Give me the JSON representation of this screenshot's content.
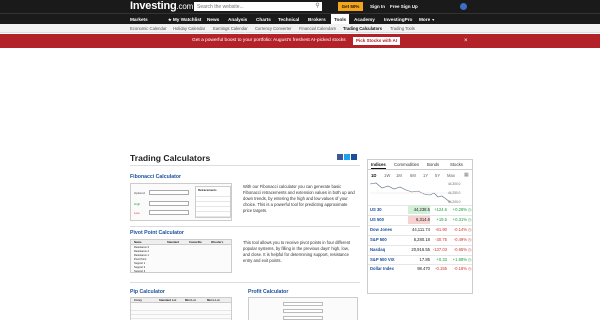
{
  "header": {
    "logo": "Investing",
    "logo_suffix": ".com",
    "search_placeholder": "Search the website...",
    "offer_label": "Get 50% Off",
    "sign_in": "Sign In",
    "free_sign_up": "Free Sign Up"
  },
  "nav": {
    "items": [
      "Markets",
      "My Watchlist",
      "News",
      "Analysis",
      "Charts",
      "Technical",
      "Brokers",
      "Tools",
      "Academy",
      "InvestingPro",
      "More"
    ]
  },
  "subnav": {
    "items": [
      "Economic Calendar",
      "Holiday Calendar",
      "Earnings Calendar",
      "Currency Converter",
      "Financial Calendars",
      "Trading Calculators",
      "Trading Tools"
    ]
  },
  "banner": {
    "text": "Get a powerful boost to your portfolio: August's freshest AI-picked stocks",
    "button": "Pick Stocks with AI",
    "close": "×"
  },
  "page": {
    "title": "Trading Calculators"
  },
  "sections": {
    "fibonacci": {
      "title": "Fibonacci Calculator",
      "description": "With our Fibonacci calculator you can generate basic Fibonacci retracements and extension values in both up and down trends, by entering the high and low values of your choice. This is a powerful tool for predicting approximate price targets.",
      "thumb_labels": [
        "Uptrend",
        "High",
        "Low"
      ],
      "thumb_header": "Retracements",
      "thumb_rows": [
        [
          "0% (a)",
          "1160.68",
          "1160.68"
        ],
        [
          "23.6%",
          "",
          ""
        ],
        [
          "38.2%",
          "",
          ""
        ],
        [
          "50%",
          "",
          ""
        ],
        [
          "61.8%",
          "",
          ""
        ]
      ]
    },
    "pivot": {
      "title": "Pivot Point Calculator",
      "description": "This tool allows you to receive pivot points in four different popular systems, by filling in the previous days' high, low, and close. It is helpful for determining support, resistance entry and exit points.",
      "thumb_headers": [
        "Name",
        "Standard",
        "Camarilla",
        "Woodie's"
      ],
      "thumb_rows": [
        "Resistance 3",
        "Resistance 2",
        "Resistance 1",
        "Pivot Point",
        "Support 1",
        "Support 2",
        "Support 3"
      ]
    },
    "pip": {
      "title": "Pip Calculator",
      "thumb_headers": [
        "Crncy",
        "Standard Lot",
        "Mini Lot",
        "Micro Lot"
      ]
    },
    "profit": {
      "title": "Profit Calculator"
    }
  },
  "widget": {
    "tabs": [
      "Indices",
      "Commodities",
      "Bonds",
      "Stocks"
    ],
    "periods": [
      "1D",
      "1W",
      "1M",
      "6M",
      "1Y",
      "5Y",
      "Max"
    ],
    "axis_labels": [
      "44,300.0",
      "44,250.0",
      "44,200.0"
    ],
    "rows": [
      {
        "name": "US 30",
        "last": "44,238.5",
        "chg": "+124.6",
        "pct": "+0.28%",
        "last_hl": "pos",
        "chg_class": "pos"
      },
      {
        "name": "US 500",
        "last": "6,314.6",
        "chg": "+19.5",
        "pct": "+0.31%",
        "last_hl": "neg",
        "chg_class": "pos"
      },
      {
        "name": "Dow Jones",
        "last": "44,111.74",
        "chg": "-61.90",
        "pct": "-0.14%",
        "last_hl": "",
        "chg_class": "neg"
      },
      {
        "name": "S&P 500",
        "last": "6,280.18",
        "chg": "-30.75",
        "pct": "-0.49%",
        "last_hl": "",
        "chg_class": "neg"
      },
      {
        "name": "Nasdaq",
        "last": "20,916.55",
        "chg": "-137.03",
        "pct": "-0.65%",
        "last_hl": "",
        "chg_class": "neg"
      },
      {
        "name": "S&P 500 VIX",
        "last": "17.85",
        "chg": "+0.33",
        "pct": "+1.88%",
        "last_hl": "",
        "chg_class": "pos"
      },
      {
        "name": "Dollar Index",
        "last": "98.470",
        "chg": "-0.155",
        "pct": "-0.16%",
        "last_hl": "",
        "chg_class": "neg"
      }
    ]
  },
  "colors": {
    "header_bg": "#1a1a1a",
    "banner_bg": "#b42229",
    "link_blue": "#1a4f9c",
    "offer": "#f4a51c"
  }
}
